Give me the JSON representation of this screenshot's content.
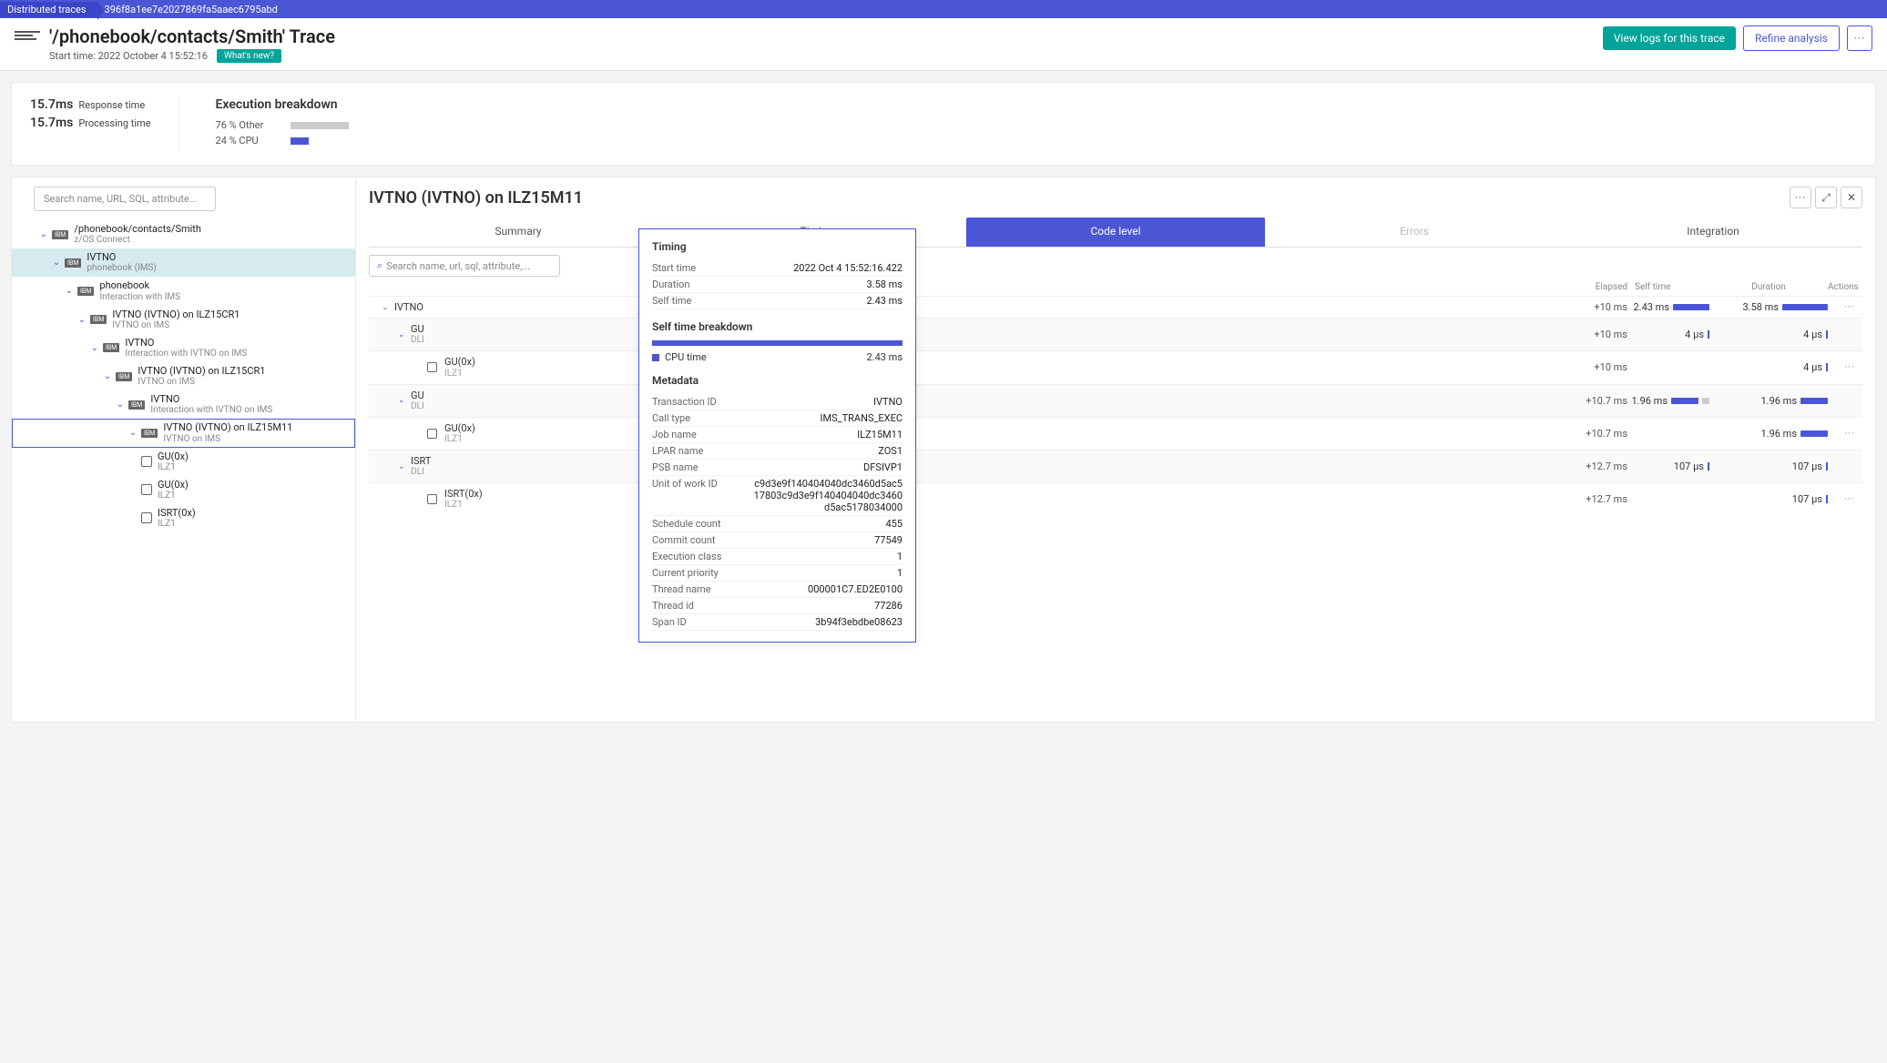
{
  "breadcrumb": {
    "root": "Distributed traces",
    "id": "396f8a1ee7e2027869fa5aaec6795abd"
  },
  "header": {
    "title": "'/phonebook/contacts/Smith' Trace",
    "starttime_label": "Start time:",
    "starttime_value": "2022 October 4 15:52:16",
    "whats_new": "What's new?",
    "view_logs": "View logs for this trace",
    "refine": "Refine analysis"
  },
  "summary": {
    "response_time_val": "15.7ms",
    "response_time_label": "Response time",
    "processing_time_val": "15.7ms",
    "processing_time_label": "Processing time",
    "breakdown_title": "Execution breakdown",
    "other_pct": "76 %",
    "other_label": "Other",
    "cpu_pct": "24 %",
    "cpu_label": "CPU"
  },
  "tree_search_placeholder": "Search name, URL, SQL, attribute...",
  "tree": [
    {
      "indent": 0,
      "type": "caret",
      "tech": "IBM",
      "name": "/phonebook/contacts/Smith",
      "sub": "z/OS Connect"
    },
    {
      "indent": 1,
      "type": "caret",
      "tech": "IBM",
      "name": "IVTNO",
      "sub": "phonebook (IMS)",
      "highlight": true
    },
    {
      "indent": 2,
      "type": "caret",
      "tech": "IBM",
      "name": "phonebook",
      "sub": "Interaction with IMS"
    },
    {
      "indent": 3,
      "type": "caret",
      "tech": "IBM",
      "name": "IVTNO (IVTNO) on ILZ15CR1",
      "sub": "IVTNO on IMS"
    },
    {
      "indent": 4,
      "type": "caret",
      "tech": "IBM",
      "name": "IVTNO",
      "sub": "Interaction with IVTNO on IMS"
    },
    {
      "indent": 5,
      "type": "caret",
      "tech": "IBM",
      "name": "IVTNO (IVTNO) on ILZ15CR1",
      "sub": "IVTNO on IMS"
    },
    {
      "indent": 6,
      "type": "caret",
      "tech": "IBM",
      "name": "IVTNO",
      "sub": "Interaction with IVTNO on IMS"
    },
    {
      "indent": 7,
      "type": "caret",
      "tech": "IBM",
      "name": "IVTNO (IVTNO) on ILZ15M11",
      "sub": "IVTNO on IMS",
      "selected": true
    },
    {
      "indent": 8,
      "type": "cube",
      "name": "GU(0x<masked>)",
      "sub": "ILZ1"
    },
    {
      "indent": 8,
      "type": "cube",
      "name": "GU(0x<masked>)",
      "sub": "ILZ1"
    },
    {
      "indent": 8,
      "type": "cube",
      "name": "ISRT(0x<masked>)",
      "sub": "ILZ1"
    }
  ],
  "detail": {
    "title": "IVTNO (IVTNO) on ILZ15M11",
    "tabs": {
      "summary": "Summary",
      "timing": "Timing",
      "code": "Code level",
      "errors": "Errors",
      "integration": "Integration"
    },
    "search_placeholder": "Search name, url, sql, attribute,...",
    "cols": {
      "elapsed": "Elapsed",
      "self": "Self time",
      "duration": "Duration",
      "actions": "Actions"
    },
    "rows": [
      {
        "indent": 0,
        "caret": true,
        "name": "IVTNO",
        "sub": "",
        "cube": false,
        "el": "+10 ms",
        "self": "2.43 ms",
        "selfbar": 40,
        "dur": "3.58 ms",
        "durbar": 50,
        "actions": true
      },
      {
        "indent": 1,
        "caret": true,
        "name": "GU",
        "sub": "DLI",
        "cube": false,
        "el": "+10 ms",
        "self": "4 µs",
        "selftick": true,
        "dur": "4 µs",
        "durtick": true,
        "actions": false
      },
      {
        "indent": 2,
        "caret": false,
        "name": "GU(0x<masked>)",
        "sub": "ILZ1",
        "cube": true,
        "el": "+10 ms",
        "self": "",
        "dur": "4 µs",
        "durtick": true,
        "actions": true
      },
      {
        "indent": 1,
        "caret": true,
        "name": "GU",
        "sub": "DLI",
        "cube": false,
        "el": "+10.7 ms",
        "self": "1.96 ms",
        "selfbar": 30,
        "graybar": true,
        "dur": "1.96 ms",
        "durbar": 30,
        "actions": false
      },
      {
        "indent": 2,
        "caret": false,
        "name": "GU(0x<masked>)",
        "sub": "ILZ1",
        "cube": true,
        "el": "+10.7 ms",
        "self": "",
        "dur": "1.96 ms",
        "durbar": 30,
        "actions": true
      },
      {
        "indent": 1,
        "caret": true,
        "name": "ISRT",
        "sub": "DLI",
        "cube": false,
        "el": "+12.7 ms",
        "self": "107 µs",
        "selftick": true,
        "dur": "107 µs",
        "durtick": true,
        "actions": false
      },
      {
        "indent": 2,
        "caret": false,
        "name": "ISRT(0x<masked>)",
        "sub": "ILZ1",
        "cube": true,
        "el": "+12.7 ms",
        "self": "",
        "dur": "107 µs",
        "durtick": true,
        "actions": true
      }
    ]
  },
  "popup": {
    "timing_title": "Timing",
    "start_k": "Start time",
    "start_v": "2022 Oct 4 15:52:16.422",
    "dur_k": "Duration",
    "dur_v": "3.58 ms",
    "self_k": "Self time",
    "self_v": "2.43 ms",
    "stb_title": "Self time breakdown",
    "cpu_label": "CPU time",
    "cpu_val": "2.43 ms",
    "meta_title": "Metadata",
    "meta": [
      {
        "k": "Transaction ID",
        "v": "IVTNO"
      },
      {
        "k": "Call type",
        "v": "IMS_TRANS_EXEC"
      },
      {
        "k": "Job name",
        "v": "ILZ15M11"
      },
      {
        "k": "LPAR name",
        "v": "ZOS1"
      },
      {
        "k": "PSB name",
        "v": "DFSIVP1"
      },
      {
        "k": "Unit of work ID",
        "v": "c9d3e9f140404040dc3460d5ac517803c9d3e9f140404040dc3460d5ac5178034000"
      },
      {
        "k": "Schedule count",
        "v": "455"
      },
      {
        "k": "Commit count",
        "v": "77549"
      },
      {
        "k": "Execution class",
        "v": "1"
      },
      {
        "k": "Current priority",
        "v": "1"
      },
      {
        "k": "Thread name",
        "v": "000001C7.ED2E0100"
      },
      {
        "k": "Thread id",
        "v": "77286"
      },
      {
        "k": "Span ID",
        "v": "3b94f3ebdbe08623"
      }
    ]
  }
}
